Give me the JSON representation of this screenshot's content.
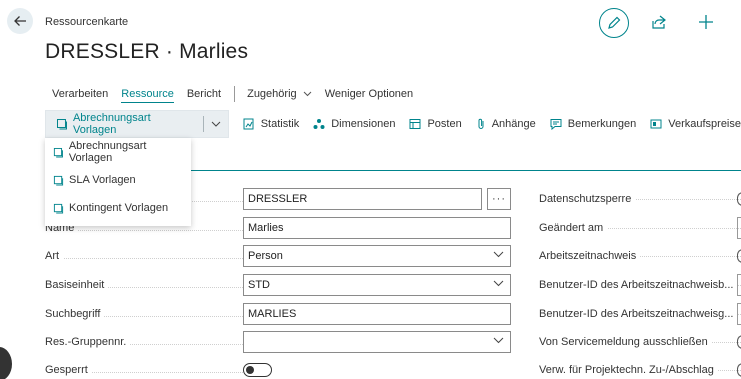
{
  "page": {
    "caption": "Ressourcenkarte",
    "title": "DRESSLER · Marlies"
  },
  "header_actions": {
    "back": "arrow-left-icon",
    "edit": "pencil-icon",
    "share": "share-icon",
    "new": "plus-icon"
  },
  "menu": {
    "items": [
      "Verarbeiten",
      "Ressource",
      "Bericht",
      "Zugehörig",
      "Weniger Optionen"
    ],
    "active": "Ressource"
  },
  "actions": {
    "split_label": "Abrechnungsart Vorlagen",
    "items": [
      "Statistik",
      "Dimensionen",
      "Posten",
      "Anhänge",
      "Bemerkungen",
      "Verkaufspreise"
    ]
  },
  "dropdown": {
    "items": [
      "Abrechnungsart Vorlagen",
      "SLA Vorlagen",
      "Kontingent Vorlagen"
    ]
  },
  "fields_left": [
    {
      "label": "",
      "value": "DRESSLER",
      "kind": "text-more"
    },
    {
      "label": "Name",
      "value": "Marlies",
      "kind": "text"
    },
    {
      "label": "Art",
      "value": "Person",
      "kind": "select"
    },
    {
      "label": "Basiseinheit",
      "value": "STD",
      "kind": "select"
    },
    {
      "label": "Suchbegriff",
      "value": "MARLIES",
      "kind": "text"
    },
    {
      "label": "Res.-Gruppennr.",
      "value": "",
      "kind": "select"
    },
    {
      "label": "Gesperrt",
      "value": "off",
      "kind": "toggle"
    }
  ],
  "fields_right": [
    "Datenschutzsperre",
    "Geändert am",
    "Arbeitszeitnachweis",
    "Benutzer-ID des Arbeitszeitnachweisb...",
    "Benutzer-ID des Arbeitszeitnachweisg...",
    "Von Servicemeldung ausschließen",
    "Verw. für Projektechn. Zu-/Abschlag"
  ],
  "colors": {
    "accent": "#00848c",
    "actionbar_bg": "#e9eef1",
    "back_bg": "#e6eef2"
  }
}
